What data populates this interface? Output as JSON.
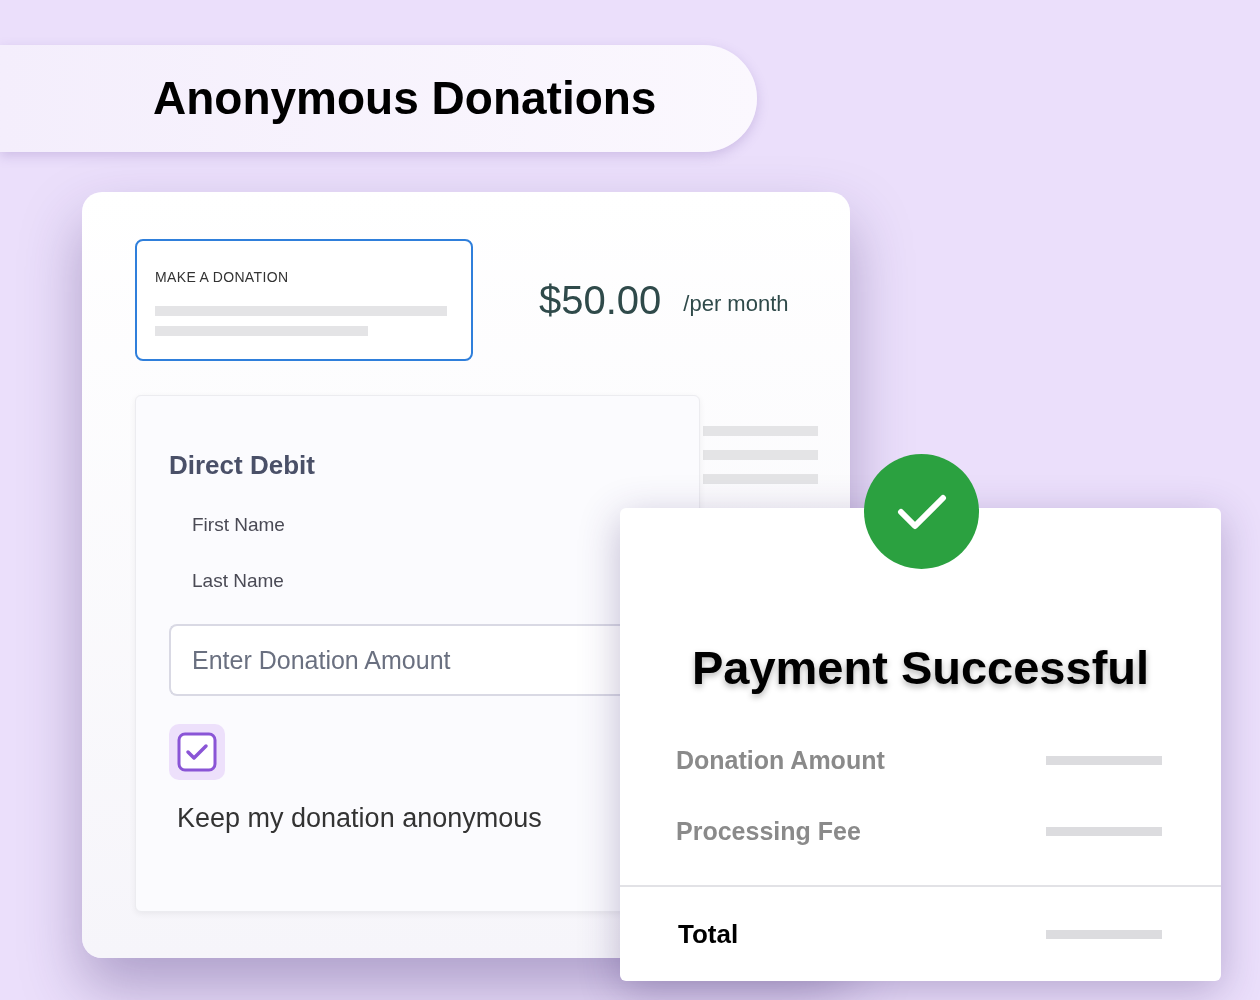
{
  "header": {
    "title": "Anonymous Donations"
  },
  "donation_form": {
    "heading_box": {
      "label": "MAKE A DONATION"
    },
    "amount": "$50.00",
    "period": "/per month",
    "section": {
      "title": "Direct Debit",
      "fields": [
        "First Name",
        "Last Name"
      ],
      "amount_input": {
        "placeholder": "Enter Donation Amount"
      },
      "anonymous": {
        "checked": true,
        "label": "Keep my donation anonymous"
      }
    }
  },
  "receipt": {
    "title": "Payment Successful",
    "rows": [
      {
        "label": "Donation Amount"
      },
      {
        "label": "Processing Fee"
      }
    ],
    "total": {
      "label": "Total"
    }
  }
}
